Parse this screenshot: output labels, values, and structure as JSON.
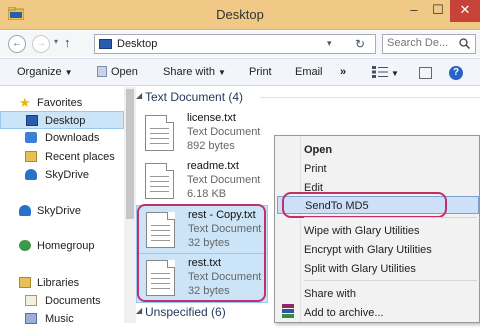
{
  "window": {
    "title": "Desktop",
    "minimize": "–",
    "maximize": "☐",
    "close": "✕"
  },
  "address": {
    "path": "Desktop",
    "search_placeholder": "Search De..."
  },
  "toolbar": {
    "organize": "Organize",
    "open": "Open",
    "share_with": "Share with",
    "print": "Print",
    "email": "Email",
    "more": "»"
  },
  "nav": {
    "favorites": "Favorites",
    "desktop": "Desktop",
    "downloads": "Downloads",
    "recent_places": "Recent places",
    "skydrive_fav": "SkyDrive",
    "skydrive": "SkyDrive",
    "homegroup": "Homegroup",
    "libraries": "Libraries",
    "documents": "Documents",
    "music": "Music"
  },
  "groups": {
    "text_document": "Text Document (4)",
    "unspecified": "Unspecified (6)"
  },
  "files": [
    {
      "name": "license.txt",
      "type": "Text Document",
      "size": "892 bytes"
    },
    {
      "name": "readme.txt",
      "type": "Text Document",
      "size": "6.18 KB"
    },
    {
      "name": "rest - Copy.txt",
      "type": "Text Document",
      "size": "32 bytes"
    },
    {
      "name": "rest.txt",
      "type": "Text Document",
      "size": "32 bytes"
    }
  ],
  "context_menu": {
    "open": "Open",
    "print": "Print",
    "edit": "Edit",
    "sendto_md5": "SendTo MD5",
    "wipe": "Wipe with Glary Utilities",
    "encrypt": "Encrypt with Glary Utilities",
    "split": "Split with Glary Utilities",
    "share_with": "Share with",
    "add_to_archive": "Add to archive..."
  },
  "colors": {
    "titlebar": "#f0c987",
    "selection": "#cce4f7",
    "annotation": "#c0306a",
    "accent": "#2a62c9"
  }
}
